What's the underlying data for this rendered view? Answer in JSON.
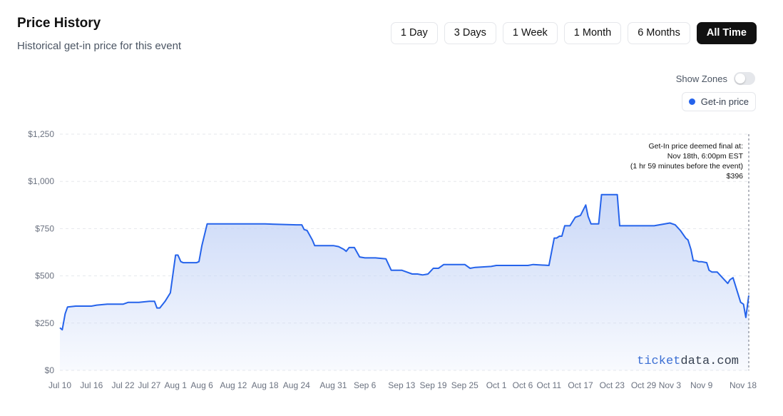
{
  "header": {
    "title": "Price History",
    "subtitle": "Historical get-in price for this event"
  },
  "ranges": [
    {
      "label": "1 Day",
      "active": false
    },
    {
      "label": "3 Days",
      "active": false
    },
    {
      "label": "1 Week",
      "active": false
    },
    {
      "label": "1 Month",
      "active": false
    },
    {
      "label": "6 Months",
      "active": false
    },
    {
      "label": "All Time",
      "active": true
    }
  ],
  "zones": {
    "label": "Show Zones",
    "enabled": false
  },
  "legend": {
    "label": "Get-in price",
    "color": "#2563eb"
  },
  "annotation": {
    "lines": [
      "Get-In price deemed final at:",
      "Nov 18th, 6:00pm EST",
      "(1 hr 59 minutes before the event)",
      "$396"
    ]
  },
  "watermark": {
    "part1": "ticket",
    "part2": "data.com",
    "color1": "#3b6fd4",
    "color2": "#374151"
  },
  "colors": {
    "line": "#2563eb",
    "fill": "#c7d6f7",
    "grid": "#e5e7eb"
  },
  "chart_data": {
    "type": "area",
    "title": "",
    "xlabel": "",
    "ylabel": "",
    "ylim": [
      0,
      1250
    ],
    "yticks": [
      0,
      250,
      500,
      750,
      1000,
      1250
    ],
    "ytick_labels": [
      "$0",
      "$250",
      "$500",
      "$750",
      "$1,000",
      "$1,250"
    ],
    "xlim": [
      "2025-07-10",
      "2025-11-18"
    ],
    "xticks": [
      {
        "label": "Jul 10",
        "date": "2025-07-10"
      },
      {
        "label": "Jul 16",
        "date": "2025-07-16"
      },
      {
        "label": "Jul 22",
        "date": "2025-07-22"
      },
      {
        "label": "Jul 27",
        "date": "2025-07-27"
      },
      {
        "label": "Aug 1",
        "date": "2025-08-01"
      },
      {
        "label": "Aug 6",
        "date": "2025-08-06"
      },
      {
        "label": "Aug 12",
        "date": "2025-08-12"
      },
      {
        "label": "Aug 18",
        "date": "2025-08-18"
      },
      {
        "label": "Aug 24",
        "date": "2025-08-24"
      },
      {
        "label": "Aug 31",
        "date": "2025-08-31"
      },
      {
        "label": "Sep 6",
        "date": "2025-09-06"
      },
      {
        "label": "Sep 13",
        "date": "2025-09-13"
      },
      {
        "label": "Sep 19",
        "date": "2025-09-19"
      },
      {
        "label": "Sep 25",
        "date": "2025-09-25"
      },
      {
        "label": "Oct 1",
        "date": "2025-10-01"
      },
      {
        "label": "Oct 6",
        "date": "2025-10-06"
      },
      {
        "label": "Oct 11",
        "date": "2025-10-11"
      },
      {
        "label": "Oct 17",
        "date": "2025-10-17"
      },
      {
        "label": "Oct 23",
        "date": "2025-10-23"
      },
      {
        "label": "Oct 29",
        "date": "2025-10-29"
      },
      {
        "label": "Nov 3",
        "date": "2025-11-03"
      },
      {
        "label": "Nov 9",
        "date": "2025-11-09"
      },
      {
        "label": "Nov 18",
        "date": "2025-11-18"
      }
    ],
    "grid": true,
    "series": [
      {
        "name": "Get-in price",
        "x": [
          "2025-07-10",
          "2025-07-10",
          "2025-07-11",
          "2025-07-11",
          "2025-07-13",
          "2025-07-14",
          "2025-07-15",
          "2025-07-16",
          "2025-07-17",
          "2025-07-19",
          "2025-07-20",
          "2025-07-22",
          "2025-07-23",
          "2025-07-25",
          "2025-07-27",
          "2025-07-27",
          "2025-07-28",
          "2025-07-28",
          "2025-07-29",
          "2025-07-30",
          "2025-07-31",
          "2025-08-01",
          "2025-08-01",
          "2025-08-02",
          "2025-08-02",
          "2025-08-03",
          "2025-08-05",
          "2025-08-05",
          "2025-08-06",
          "2025-08-07",
          "2025-08-07",
          "2025-08-14",
          "2025-08-18",
          "2025-08-24",
          "2025-08-25",
          "2025-08-25",
          "2025-08-26",
          "2025-08-27",
          "2025-08-27",
          "2025-08-31",
          "2025-09-01",
          "2025-09-02",
          "2025-09-02",
          "2025-09-03",
          "2025-09-04",
          "2025-09-05",
          "2025-09-06",
          "2025-09-08",
          "2025-09-10",
          "2025-09-11",
          "2025-09-13",
          "2025-09-15",
          "2025-09-16",
          "2025-09-17",
          "2025-09-18",
          "2025-09-19",
          "2025-09-20",
          "2025-09-21",
          "2025-09-24",
          "2025-09-25",
          "2025-09-26",
          "2025-09-27",
          "2025-09-30",
          "2025-10-01",
          "2025-10-04",
          "2025-10-06",
          "2025-10-07",
          "2025-10-08",
          "2025-10-11",
          "2025-10-12",
          "2025-10-12",
          "2025-10-13",
          "2025-10-13",
          "2025-10-14",
          "2025-10-14",
          "2025-10-15",
          "2025-10-16",
          "2025-10-17",
          "2025-10-18",
          "2025-10-18",
          "2025-10-19",
          "2025-10-19",
          "2025-10-20",
          "2025-10-20",
          "2025-10-21",
          "2025-10-23",
          "2025-10-24",
          "2025-10-24",
          "2025-10-27",
          "2025-10-28",
          "2025-10-28",
          "2025-10-31",
          "2025-11-03",
          "2025-11-04",
          "2025-11-05",
          "2025-11-06",
          "2025-11-06",
          "2025-11-07",
          "2025-11-07",
          "2025-11-08",
          "2025-11-08",
          "2025-11-09",
          "2025-11-10",
          "2025-11-10",
          "2025-11-11",
          "2025-11-12",
          "2025-11-14",
          "2025-11-14",
          "2025-11-15",
          "2025-11-16",
          "2025-11-16",
          "2025-11-17",
          "2025-11-17",
          "2025-11-18",
          "2025-11-18",
          "2025-11-18"
        ],
        "values": [
          225,
          215,
          300,
          335,
          340,
          340,
          340,
          340,
          345,
          350,
          350,
          350,
          360,
          360,
          365,
          365,
          365,
          330,
          330,
          365,
          410,
          610,
          610,
          575,
          570,
          570,
          570,
          575,
          660,
          775,
          775,
          775,
          775,
          770,
          770,
          745,
          740,
          690,
          660,
          660,
          655,
          640,
          630,
          650,
          650,
          600,
          595,
          595,
          590,
          530,
          530,
          510,
          510,
          505,
          510,
          540,
          540,
          560,
          560,
          560,
          540,
          545,
          550,
          555,
          555,
          555,
          555,
          560,
          555,
          700,
          700,
          710,
          710,
          765,
          765,
          765,
          810,
          820,
          875,
          815,
          775,
          775,
          775,
          775,
          930,
          930,
          930,
          765,
          765,
          765,
          765,
          765,
          780,
          770,
          740,
          700,
          690,
          640,
          580,
          580,
          575,
          575,
          570,
          530,
          520,
          520,
          460,
          480,
          490,
          400,
          360,
          350,
          280,
          396,
          396,
          396
        ]
      }
    ]
  }
}
